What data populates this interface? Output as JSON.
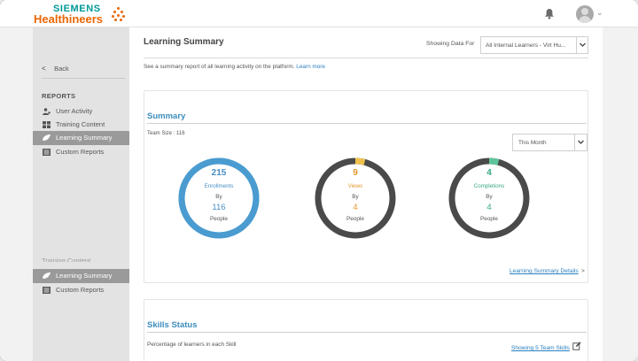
{
  "brand": {
    "line1": "SIEMENS",
    "line2": "Healthineers"
  },
  "header": {
    "bell_icon": "bell-icon",
    "avatar_icon": "user-avatar-icon"
  },
  "sidebar": {
    "back_label": "Back",
    "reports_heading": "REPORTS",
    "items": [
      {
        "label": "User Activity",
        "icon": "user-activity-icon"
      },
      {
        "label": "Training Content",
        "icon": "training-content-icon"
      },
      {
        "label": "Learning Summary",
        "icon": "learning-summary-icon",
        "active": true
      },
      {
        "label": "Custom Reports",
        "icon": "custom-reports-icon"
      }
    ],
    "ghost_item": "Training Content",
    "duplicate_items": [
      {
        "label": "Learning Summary",
        "active": true
      },
      {
        "label": "Custom Reports"
      }
    ]
  },
  "page": {
    "title": "Learning Summary",
    "showing_label": "Showing Data For",
    "learner_select_value": "All Internal Learners - Virt Hu...",
    "description": "See a summary report of all learning activity on the platform.",
    "learn_more": "Learn more"
  },
  "summary": {
    "title": "Summary",
    "team_size": "Team Size : 116",
    "period_value": "This Month",
    "rings": [
      {
        "value": "215",
        "metric": "Enrollments",
        "by": "By",
        "team": "116",
        "people": "People",
        "fraction": 1.0,
        "color": "#4a9bd0",
        "track": "#4a9bd0",
        "text_color": "#4a8fc4"
      },
      {
        "value": "9",
        "metric": "Views",
        "by": "By",
        "team": "4",
        "people": "People",
        "fraction": 0.04,
        "color": "#f0c24b",
        "track": "#4a4a4a",
        "text_color": "#e0972c"
      },
      {
        "value": "4",
        "metric": "Completions",
        "by": "By",
        "team": "4",
        "people": "People",
        "fraction": 0.04,
        "color": "#5ec49a",
        "track": "#4a4a4a",
        "text_color": "#3aa788"
      }
    ],
    "details_link": "Learning Summary Details",
    "details_caret": ">"
  },
  "skills": {
    "title": "Skills Status",
    "subtitle": "Percentage of learners in each Skill",
    "link": "Showing 5 Team Skills"
  },
  "colors": {
    "accent_blue": "#3c8dbc",
    "brand_teal": "#009999",
    "brand_orange": "#ec6602"
  }
}
